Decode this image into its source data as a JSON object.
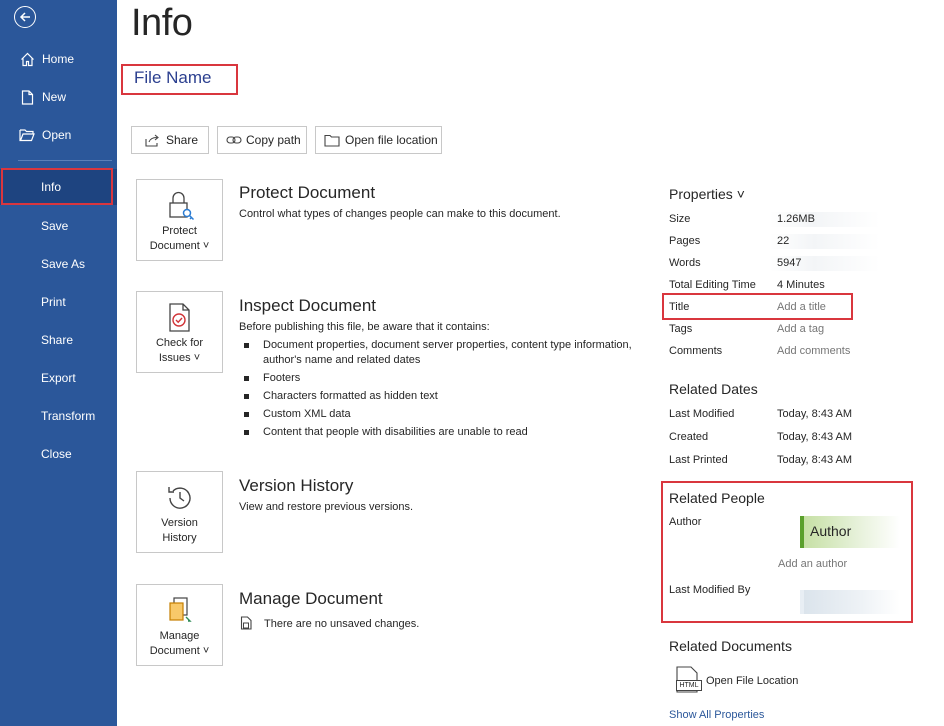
{
  "sidebar": {
    "items": [
      {
        "label": "Home",
        "icon": "home-icon"
      },
      {
        "label": "New",
        "icon": "new-document-icon"
      },
      {
        "label": "Open",
        "icon": "folder-open-icon"
      },
      {
        "label": "Info"
      },
      {
        "label": "Save"
      },
      {
        "label": "Save As"
      },
      {
        "label": "Print"
      },
      {
        "label": "Share"
      },
      {
        "label": "Export"
      },
      {
        "label": "Transform"
      },
      {
        "label": "Close"
      }
    ],
    "active": "Info",
    "accent": "#2b579a"
  },
  "main": {
    "title": "Info",
    "file_name": "File Name",
    "buttons": {
      "share": "Share",
      "copy_path": "Copy path",
      "open_location": "Open file location"
    },
    "protect": {
      "tile_line1": "Protect",
      "tile_line2": "Document ˅",
      "title": "Protect Document",
      "desc": "Control what types of changes people can make to this document."
    },
    "inspect": {
      "tile_line1": "Check for",
      "tile_line2": "Issues ˅",
      "title": "Inspect Document",
      "desc": "Before publishing this file, be aware that it contains:",
      "bullets": [
        "Document properties, document server properties, content type information, author's name and related dates",
        "Footers",
        "Characters formatted as hidden text",
        "Custom XML data",
        "Content that people with disabilities are unable to read"
      ]
    },
    "version": {
      "tile_line1": "Version",
      "tile_line2": "History",
      "title": "Version History",
      "desc": "View and restore previous versions."
    },
    "manage": {
      "tile_line1": "Manage",
      "tile_line2": "Document ˅",
      "title": "Manage Document",
      "desc": "There are no unsaved changes."
    }
  },
  "properties": {
    "heading": "Properties ˅",
    "rows": [
      {
        "key": "Size",
        "value": "1.26MB"
      },
      {
        "key": "Pages",
        "value": "22"
      },
      {
        "key": "Words",
        "value": "5947"
      },
      {
        "key": "Total Editing Time",
        "value": "4 Minutes"
      },
      {
        "key": "Title",
        "value": "Add a title"
      },
      {
        "key": "Tags",
        "value": "Add a tag"
      },
      {
        "key": "Comments",
        "value": "Add comments"
      }
    ]
  },
  "related_dates": {
    "heading": "Related Dates",
    "rows": [
      {
        "key": "Last Modified",
        "value": "Today, 8:43 AM"
      },
      {
        "key": "Created",
        "value": "Today, 8:43 AM"
      },
      {
        "key": "Last Printed",
        "value": "Today, 8:43 AM"
      }
    ]
  },
  "related_people": {
    "heading": "Related People",
    "author_label": "Author",
    "author_name": "Author",
    "add_author": "Add an author",
    "last_modified_by_label": "Last Modified By"
  },
  "related_documents": {
    "heading": "Related Documents",
    "open_file_location": "Open File Location",
    "html_badge": "HTML",
    "show_all": "Show All Properties"
  }
}
